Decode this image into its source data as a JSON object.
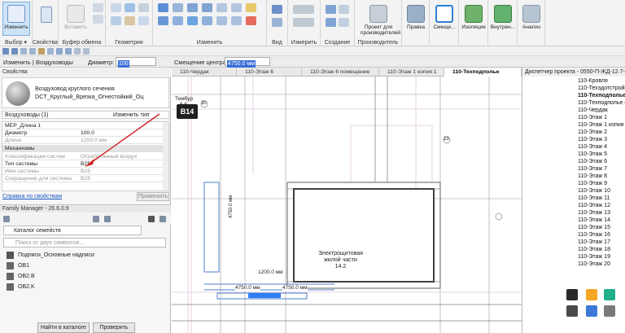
{
  "ribbon": {
    "groups": [
      {
        "label": "Выбор ▾"
      },
      {
        "label": "Свойства"
      },
      {
        "label": "Буфер обмена"
      },
      {
        "label": "Геометрия"
      },
      {
        "label": "Изменить"
      },
      {
        "label": "Вид"
      },
      {
        "label": "Измерить"
      },
      {
        "label": "Создание"
      },
      {
        "label": "Производитель"
      }
    ],
    "buttons": {
      "modify": "Изменить",
      "paste": "Вставить",
      "project_for_manufacturers": "Проект для производителей",
      "edit": "Правка",
      "offset": "Смеще...",
      "insulation": "Изоляция",
      "lining": "Внутрен...",
      "analysis": "Анализ"
    }
  },
  "options_bar": {
    "context": "Изменить | Воздуховоды",
    "diameter_label": "Диаметр:",
    "diameter_value": "100",
    "offset_label": "Смещение центра:",
    "offset_value": "4750.0 мм"
  },
  "properties": {
    "title": "Свойства",
    "type_line1": "Воздуховод круглого сечения",
    "type_line2": "DCT_Круглый_Врезка_Огнестойкий_Оц",
    "filter": "Воздуховоды (1)",
    "edit_type": "Изменить тип",
    "rows": [
      {
        "k": "MEP_Длина 1",
        "v": ""
      },
      {
        "k": "Диаметр",
        "v": "100.0"
      },
      {
        "k": "Длина",
        "v": "1200.0 мм"
      }
    ],
    "section": "Механизмы",
    "rows2": [
      {
        "k": "Классификация систем",
        "v": "Отработанный воздух"
      },
      {
        "k": "Тип системы",
        "v": "B25"
      },
      {
        "k": "Имя системы",
        "v": "B25"
      },
      {
        "k": "Сокращение для системы",
        "v": "B25"
      }
    ],
    "help": "Справка по свойствам",
    "apply": "Применить"
  },
  "family_manager": {
    "title": "Family Manager - 26.6.0.9",
    "catalog": "Каталог семейств",
    "search_placeholder": "Поиск от двух символов...",
    "items": [
      "Подписи_Основные надписи",
      "OB1",
      "OB2.B",
      "OB2.K"
    ],
    "find_button": "Найти в каталоге",
    "check_button": "Проверить"
  },
  "tabs": [
    {
      "label": "110-Чердак"
    },
    {
      "label": "110-Этаж 6"
    },
    {
      "label": "110-Этаж 6 помещение"
    },
    {
      "label": "110-Этаж 1 копия 1"
    },
    {
      "label": "110-Техподполье"
    }
  ],
  "canvas": {
    "tag": "B14",
    "room_name1": "Электрощитовая",
    "room_name2": "жилой части",
    "room_num": "14.2",
    "dim1": "1200.0 мм",
    "dim2": "4750.0 мм",
    "dim3": "4750.0 мм",
    "dim4": "4750.0 мм",
    "label_left": "Тембур",
    "label_6_6": "6.6",
    "mark_30": "30",
    "mark_23": "23"
  },
  "browser": {
    "title": "Диспетчер проекта - 0550-П-ЖД-12.7-",
    "items": [
      "110-Кровля",
      "110-Техэдотстройка",
      "110-Техподполье",
      "110-Техподполье с",
      "110-Чердак",
      "110-Этаж 1",
      "110-Этаж 1 копия 1",
      "110-Этаж 2",
      "110-Этаж 3",
      "110-Этаж 4",
      "110-Этаж 5",
      "110-Этаж 6",
      "110-Этаж 7",
      "110-Этаж 8",
      "110-Этаж 9",
      "110-Этаж 10",
      "110-Этаж 11",
      "110-Этаж 12",
      "110-Этаж 13",
      "110-Этаж 14",
      "110-Этаж 15",
      "110-Этаж 16",
      "110-Этаж 17",
      "110-Этаж 18",
      "110-Этаж 19",
      "110-Этаж 20"
    ]
  },
  "colors": {
    "accent": "#3a6fd8",
    "arrow": "#d01f1f",
    "selected_duct": "#2f7ef5"
  }
}
